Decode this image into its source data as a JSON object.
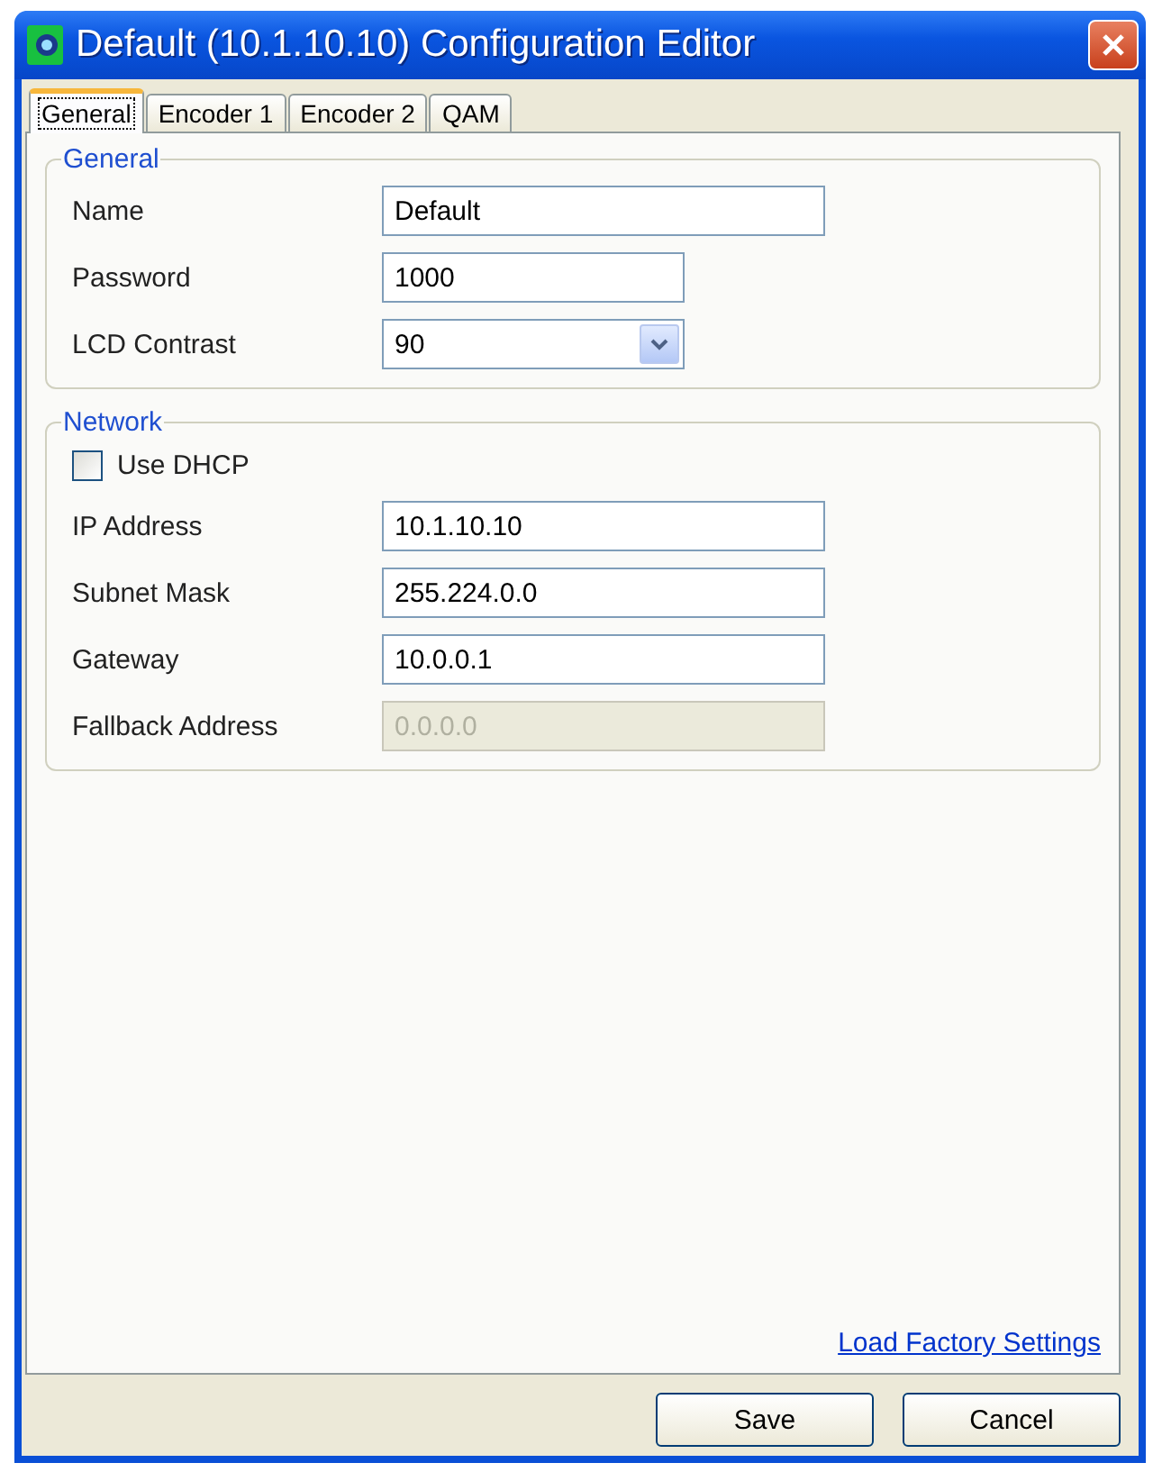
{
  "window": {
    "title": "Default (10.1.10.10) Configuration Editor"
  },
  "tabs": [
    {
      "label": "General",
      "selected": true
    },
    {
      "label": "Encoder 1",
      "selected": false
    },
    {
      "label": "Encoder 2",
      "selected": false
    },
    {
      "label": "QAM",
      "selected": false
    }
  ],
  "groups": [
    {
      "title": "General",
      "rows": [
        {
          "kind": "text",
          "label": "Name",
          "value": "Default",
          "disabled": false
        },
        {
          "kind": "short",
          "label": "Password",
          "value": "1000",
          "disabled": false
        },
        {
          "kind": "combo",
          "label": "LCD Contrast",
          "value": "90"
        }
      ]
    },
    {
      "title": "Network",
      "rows": [
        {
          "kind": "checkbox",
          "label": "Use DHCP",
          "checked": false
        },
        {
          "kind": "text",
          "label": "IP Address",
          "value": "10.1.10.10",
          "disabled": false
        },
        {
          "kind": "text",
          "label": "Subnet Mask",
          "value": "255.224.0.0",
          "disabled": false
        },
        {
          "kind": "text",
          "label": "Gateway",
          "value": "10.0.0.1",
          "disabled": false
        },
        {
          "kind": "text",
          "label": "Fallback Address",
          "value": "0.0.0.0",
          "disabled": true
        }
      ]
    }
  ],
  "link": "Load Factory Settings",
  "buttons": [
    "Save",
    "Cancel"
  ]
}
